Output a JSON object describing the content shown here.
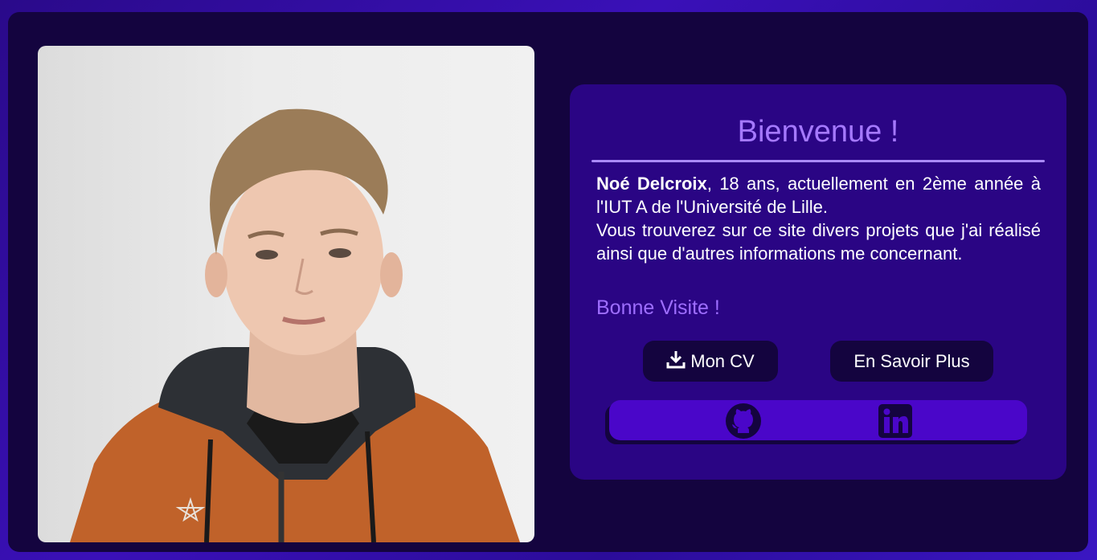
{
  "welcome": {
    "title": "Bienvenue !",
    "name": "Noé Delcroix",
    "bio_rest": ", 18 ans, actuellement en 2ème année à l'IUT A de l'Université de Lille.",
    "bio_line2": "Vous trouverez sur ce site divers projets que j'ai réalisé ainsi que d'autres informations me concernant.",
    "greeting": "Bonne Visite !"
  },
  "buttons": {
    "cv_label": "Mon CV",
    "more_label": "En Savoir Plus"
  },
  "icons": {
    "download": "download-icon",
    "github": "github-icon",
    "linkedin": "linkedin-icon"
  },
  "colors": {
    "accent": "#a579ff",
    "card": "#2a0584",
    "outer": "#14043f",
    "social_bar": "#4a06c9"
  }
}
